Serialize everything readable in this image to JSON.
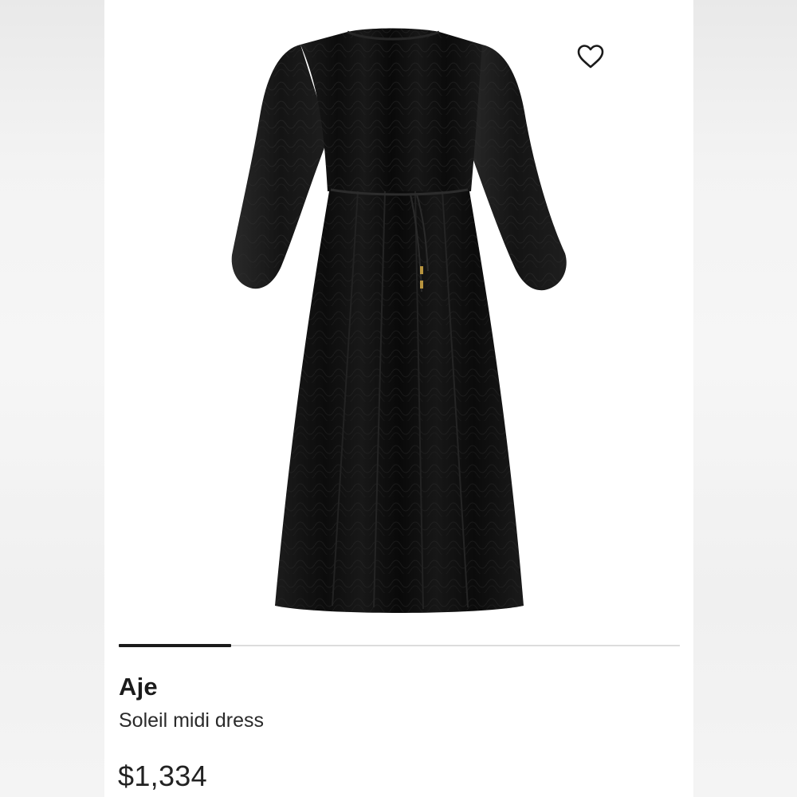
{
  "product": {
    "brand": "Aje",
    "name": "Soleil midi dress",
    "price": "$1,334",
    "image_icon": "dress-photo",
    "wishlist_icon": "heart-outline-icon"
  },
  "carousel": {
    "current_slide_fraction": 0.2
  },
  "colors": {
    "text_primary": "#1b1b1b",
    "dress": "#0d0d0d",
    "indicator_active": "#1a1a1a",
    "indicator_track": "#dcdcdc"
  }
}
